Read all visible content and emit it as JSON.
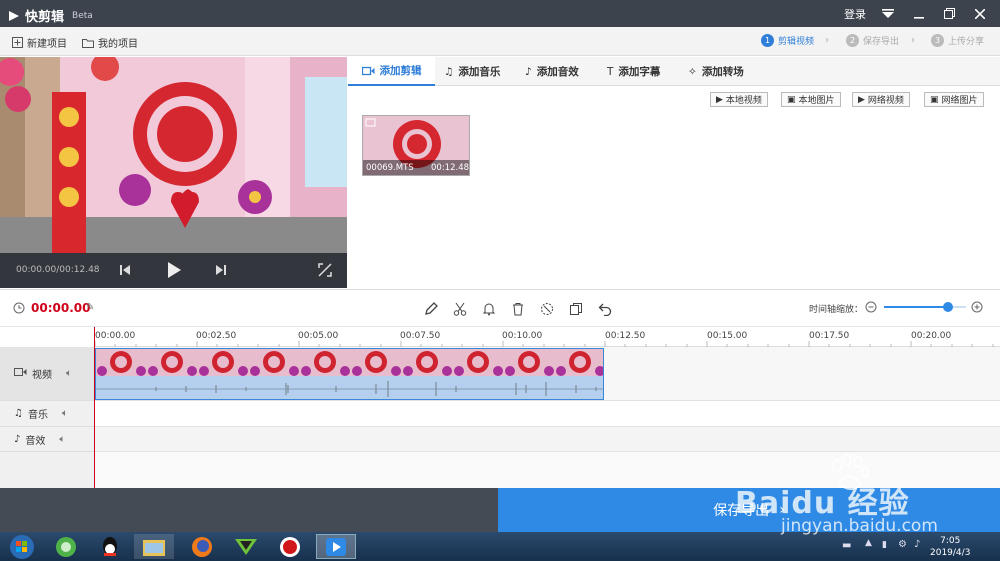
{
  "app": {
    "name": "快剪辑",
    "badge": "Beta",
    "login": "登录"
  },
  "menubar": {
    "new_project": "新建项目",
    "my_projects": "我的项目"
  },
  "steps": [
    {
      "num": "1",
      "label": "剪辑视频",
      "active": true
    },
    {
      "num": "2",
      "label": "保存导出",
      "active": false
    },
    {
      "num": "3",
      "label": "上传分享",
      "active": false
    }
  ],
  "player": {
    "time": "00:00.00/00:12.48"
  },
  "tabs": [
    {
      "label": "添加剪辑",
      "icon": "video-icon",
      "active": true
    },
    {
      "label": "添加音乐",
      "icon": "music-note-icon",
      "active": false
    },
    {
      "label": "添加音效",
      "icon": "sound-effect-icon",
      "active": false
    },
    {
      "label": "添加字幕",
      "icon": "text-icon",
      "active": false
    },
    {
      "label": "添加转场",
      "icon": "transition-wand-icon",
      "active": false
    }
  ],
  "sources": [
    "本地视频",
    "本地图片",
    "网络视频",
    "网络图片"
  ],
  "media": {
    "filename": "00069.MTS",
    "duration": "00:12.48"
  },
  "timeline": {
    "current_time": "00:00.00",
    "zoom_label": "时间轴缩放：",
    "zoom_level": 0.78,
    "ticks": [
      "00:00.00",
      "00:02.50",
      "00:05.00",
      "00:07.50",
      "00:10.00",
      "00:12.50",
      "00:15.00",
      "00:17.50",
      "00:20.00"
    ]
  },
  "tracks": [
    {
      "label": "视频",
      "icon": "video-track-icon"
    },
    {
      "label": "音乐",
      "icon": "music-track-icon"
    },
    {
      "label": "音效",
      "icon": "effect-track-icon"
    }
  ],
  "export_button": "保存导出",
  "clock": {
    "time": "7:05",
    "date": "2019/4/3"
  },
  "watermark": {
    "line1": "Baidu 经验",
    "line2": "jingyan.baidu.com"
  },
  "colors": {
    "accent": "#2f8ae5",
    "titlebar": "#3d434c",
    "playhead": "#d0021b"
  }
}
